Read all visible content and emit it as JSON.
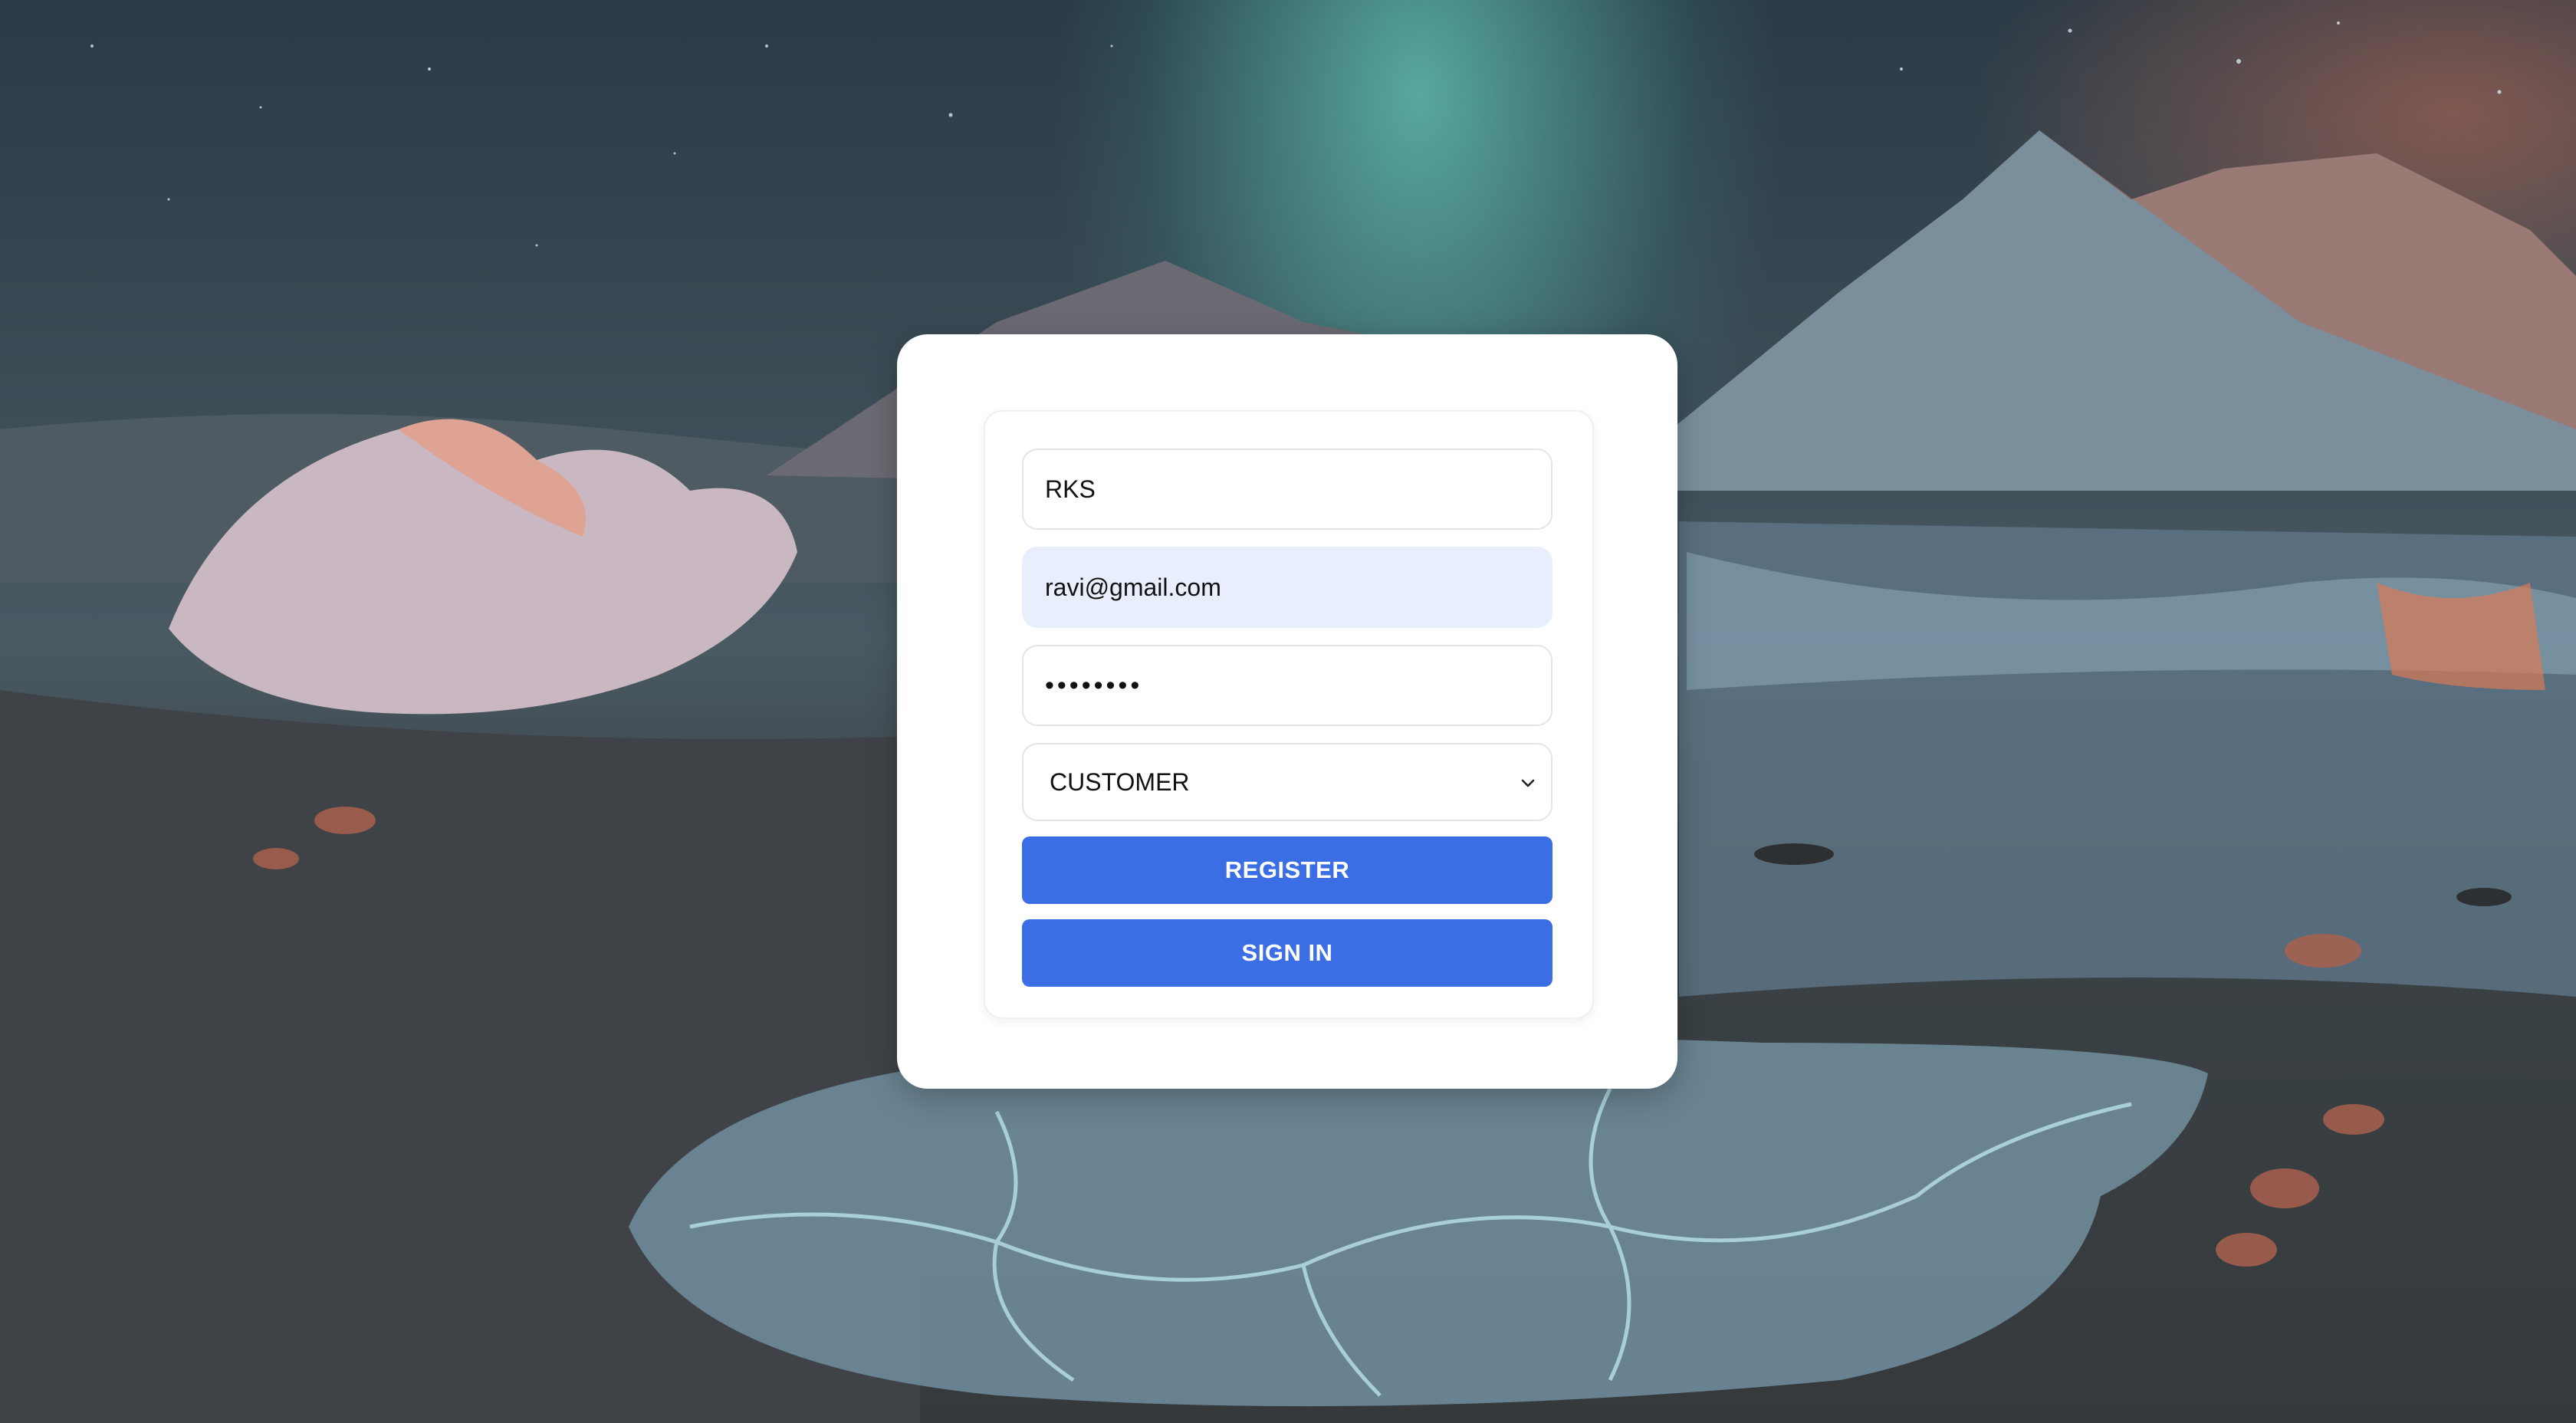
{
  "form": {
    "name_value": "RKS",
    "email_value": "ravi@gmail.com",
    "password_value": "••••••••",
    "role_selected": "CUSTOMER",
    "register_label": "REGISTER",
    "signin_label": "SIGN IN"
  },
  "colors": {
    "button": "#3b6de4",
    "autofill_bg": "#e8eefb"
  },
  "icons": {
    "select_caret": "chevron-down-icon"
  }
}
